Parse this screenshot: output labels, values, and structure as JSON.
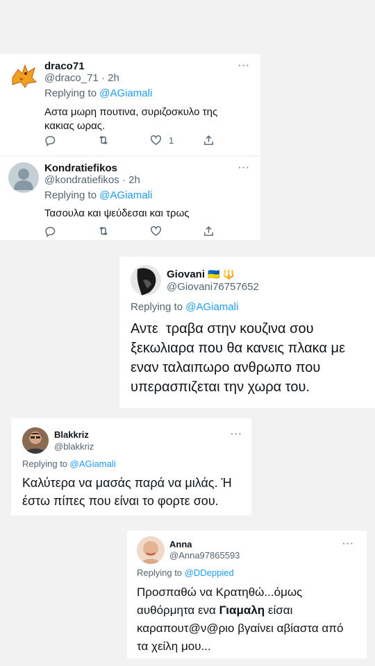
{
  "tweets": [
    {
      "name": "draco71",
      "handle": "@draco_71 · 2h",
      "reply_prefix": "Replying to ",
      "reply_to": "@AGiamali",
      "text_lines": [
        "Αστα μωρη πουτινα, συριζοσκυλο της",
        "κακιας ωρας."
      ],
      "likes": "1",
      "more": "···",
      "avatar_icon": "dragon-avatar"
    },
    {
      "name": "Kondratiefikos",
      "handle": "@kondratiefikos · 2h",
      "reply_prefix": "Replying to ",
      "reply_to": "@AGiamali",
      "text_lines": [
        "Τασουλα και ψεύδεσαι και τρως"
      ],
      "more": "···",
      "avatar_icon": "default-user-avatar"
    },
    {
      "name": "Giovani",
      "name_emoji": "🇺🇦 🔱",
      "handle": "@Giovani76757652",
      "reply_prefix": "Replying to ",
      "reply_to": "@AGiamali",
      "text_lines": [
        "Αντε  τραβα στην κουζινα σου",
        "ξεκωλιαρα που θα κανεις πλακα με",
        "εναν ταλαιπωρο ανθρωπο που",
        "υπερασπιζεται την χωρα του."
      ],
      "avatar_icon": "dark-profile-avatar"
    },
    {
      "name": "Blakkriz",
      "handle": "@blakkriz",
      "reply_prefix": "Replying to ",
      "reply_to": "@AGiamali",
      "text_lines": [
        "Καλύτερα να μασάς παρά να μιλάς. Ή",
        "έστω πίπες που είναι το φορτε σου."
      ],
      "more": "···",
      "avatar_icon": "man-portrait-avatar"
    },
    {
      "name": "Anna",
      "handle": "@Anna97865593",
      "reply_prefix": "Replying to ",
      "reply_to": "@DDeppied",
      "line1": "Προσπαθώ να Κρατηθώ...όμως",
      "line2_pre": "αυθόρμητα ενα ",
      "line2_bold": "Γιαμαλη",
      "line2_post": " είσαι",
      "line3": "καραπουτ@ν@ριο βγαίνει αβίαστα από",
      "line4": "τα χείλη μου...",
      "more": "···",
      "avatar_icon": "woman-portrait-avatar"
    }
  ],
  "colors": {
    "link": "#1d9bf0",
    "secondary": "#536471",
    "text": "#0f1419",
    "background": "#f2f2f2"
  }
}
